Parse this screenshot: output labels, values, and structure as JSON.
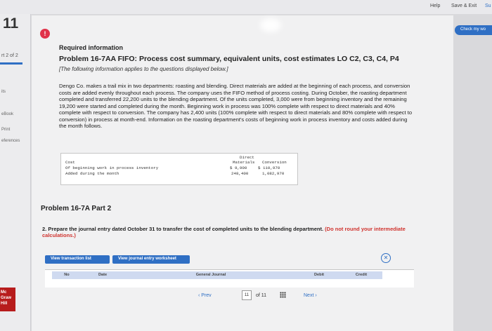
{
  "topbar": {
    "help": "Help",
    "save_exit": "Save & Exit",
    "submit": "Su"
  },
  "question": {
    "number": "11",
    "part_of": "rt 2 of 2"
  },
  "left_rail": {
    "items": [
      "its",
      "eBook",
      "Print",
      "eferences"
    ],
    "brand": "Mc\nGraw\nHill"
  },
  "check_button": "Check my wo",
  "problem": {
    "required": "Required information",
    "title": "Problem 16-7AA FIFO: Process cost summary, equivalent units, cost estimates LO C2, C3, C4, P4",
    "note": "[The following information applies to the questions displayed below.]",
    "body": "Dengo Co. makes a trail mix in two departments: roasting and blending. Direct materials are added at the beginning of each process, and conversion costs are added evenly throughout each process. The company uses the FIFO method of process costing. During October, the roasting department completed and transferred 22,200 units to the blending department. Of the units completed, 3,000 were from beginning inventory and the remaining 19,200 were started and completed during the month. Beginning work in process was 100% complete with respect to direct materials and 40% complete with respect to conversion. The company has 2,400 units (100% complete with respect to direct materials and 80% complete with respect to conversion) in process at month-end. Information on the roasting department's costs of beginning work in process inventory and costs added during the month follows."
  },
  "cost_table": {
    "header_cost": "Cost",
    "header_dm_1": "Direct",
    "header_dm_2": "Materials",
    "header_conv": "Conversion",
    "rows": [
      {
        "label": "Of beginning work in process inventory",
        "dm": "$  9,900",
        "conv": "$  110,970"
      },
      {
        "label": "Added during the month",
        "dm": "248,400",
        "conv": "1,082,970"
      }
    ]
  },
  "part": {
    "title": "Problem 16-7A Part 2",
    "instruction": "2. Prepare the journal entry dated October 31 to transfer the cost of completed units to the blending department.",
    "instruction_red": "(Do not round your intermediate calculations.)"
  },
  "buttons": {
    "view_transactions": "View transaction list",
    "view_worksheet": "View journal entry worksheet"
  },
  "journal_headers": {
    "no": "No",
    "date": "Date",
    "general_journal": "General Journal",
    "debit": "Debit",
    "credit": "Credit"
  },
  "pager": {
    "prev": "Prev",
    "current": "11",
    "of": "of 11",
    "next": "Next"
  },
  "colors": {
    "accent": "#2f6fc4",
    "alert": "#e0334a",
    "brand": "#b71c1c"
  }
}
